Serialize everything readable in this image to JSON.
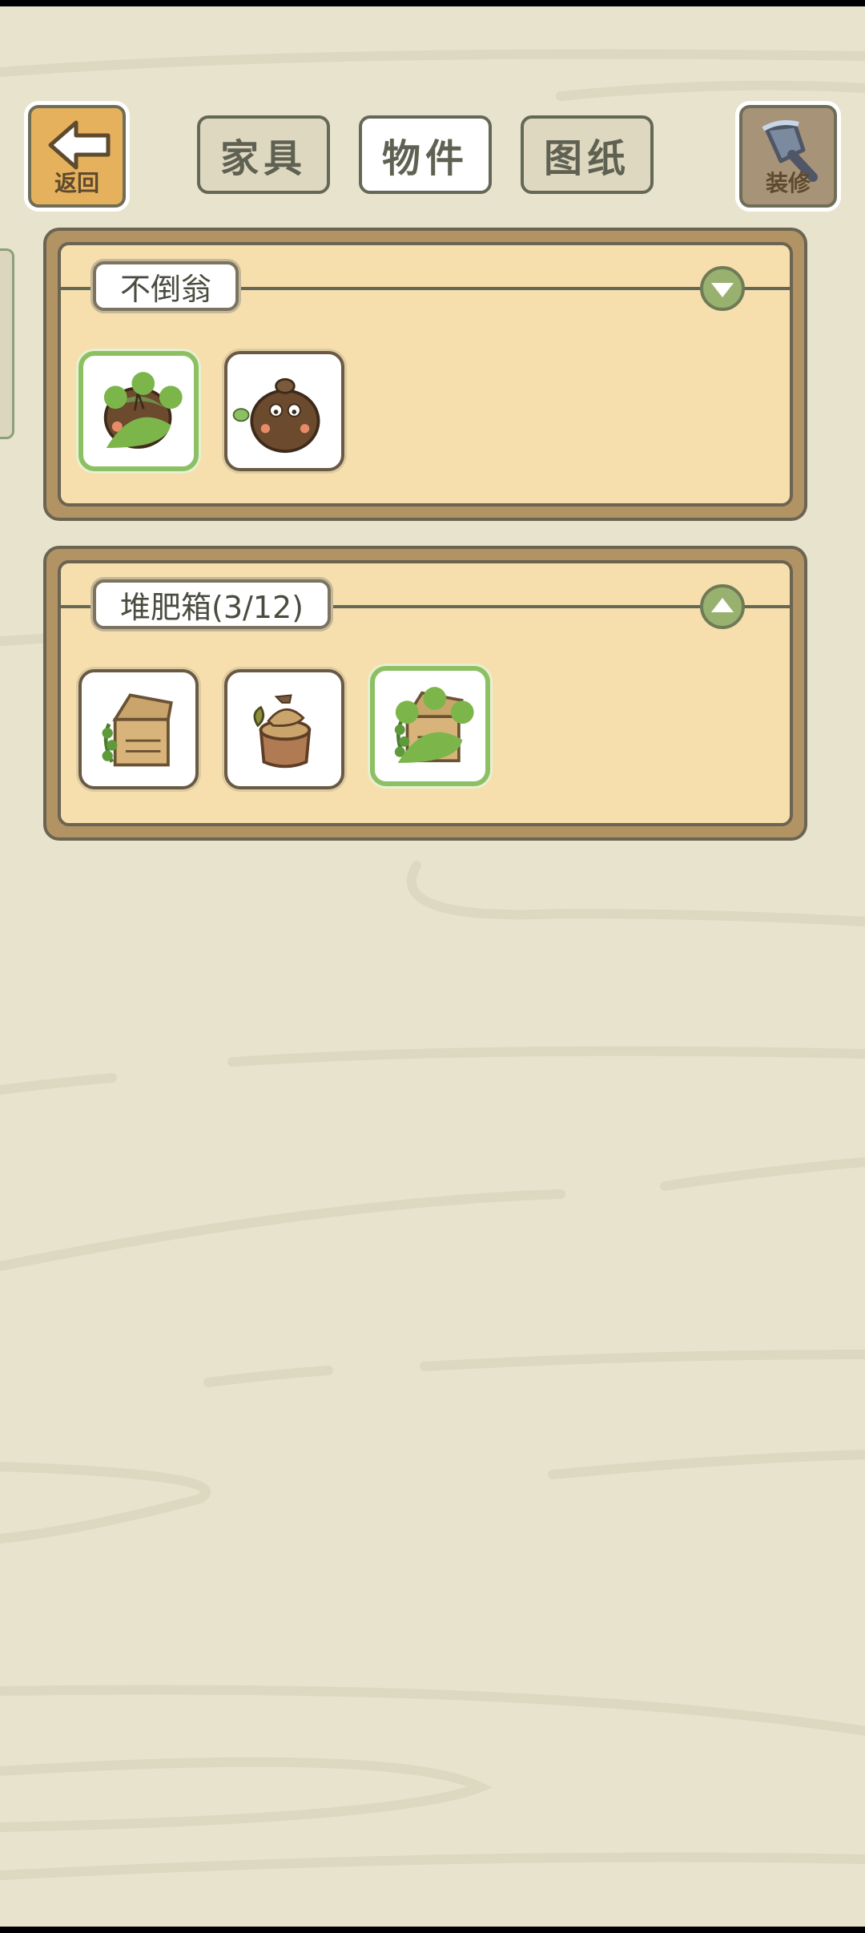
{
  "header": {
    "back_label": "返回",
    "decorate_label": "装修",
    "tabs": [
      {
        "label": "家具",
        "active": false
      },
      {
        "label": "物件",
        "active": true
      },
      {
        "label": "图纸",
        "active": false
      }
    ]
  },
  "sections": [
    {
      "title": "不倒翁",
      "expanded": true,
      "items": [
        {
          "icon": "tumbler-green-icon",
          "selected": true
        },
        {
          "icon": "tumbler-brown-icon",
          "selected": false
        }
      ]
    },
    {
      "title": "堆肥箱(3/12)",
      "expanded": false,
      "items": [
        {
          "icon": "compost-crate-icon",
          "selected": false
        },
        {
          "icon": "compost-stump-icon",
          "selected": false
        },
        {
          "icon": "compost-crate-icon",
          "selected": true
        }
      ]
    }
  ],
  "colors": {
    "background": "#e7e3cd",
    "panel_outer": "#b29363",
    "panel_inner": "#f6dfac",
    "selected_border": "#8cc063",
    "back_button": "#e6b15c"
  }
}
